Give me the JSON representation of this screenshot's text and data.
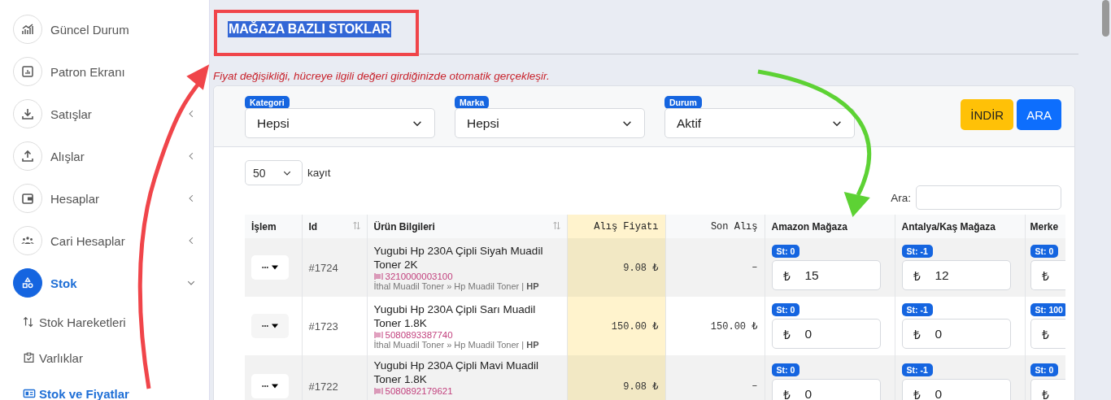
{
  "sidebar": {
    "items": [
      {
        "label": "Güncel Durum",
        "selected": false
      },
      {
        "label": "Patron Ekranı",
        "selected": false
      },
      {
        "label": "Satışlar",
        "selected": false,
        "expanded": false
      },
      {
        "label": "Alışlar",
        "selected": false,
        "expanded": false
      },
      {
        "label": "Hesaplar",
        "selected": false,
        "expanded": false
      },
      {
        "label": "Cari Hesaplar",
        "selected": false,
        "expanded": false
      },
      {
        "label": "Stok",
        "selected": true,
        "expanded": true,
        "children": [
          {
            "label": "Stok Hareketleri",
            "selected": false
          },
          {
            "label": "Varlıklar",
            "selected": false
          },
          {
            "label": "Stok ve Fiyatlar",
            "selected": true
          }
        ]
      }
    ]
  },
  "page": {
    "title": "MAĞAZA BAZLI STOKLAR",
    "note": "Fiyat değişikliği, hücreye ilgili değeri girdiğinizde otomatik gerçekleşir."
  },
  "filters": [
    {
      "label": "Kategori",
      "value": "Hepsi"
    },
    {
      "label": "Marka",
      "value": "Hepsi"
    },
    {
      "label": "Durum",
      "value": "Aktif"
    }
  ],
  "buttons": [
    {
      "label": "İNDİR",
      "kind": "warning"
    },
    {
      "label": "ARA",
      "kind": "primary"
    }
  ],
  "page_length": {
    "value": "50",
    "suffix": "kayıt"
  },
  "search": {
    "label": "Ara:"
  },
  "table": {
    "columns": [
      {
        "label": "İşlem",
        "sortable": false
      },
      {
        "label": "Id",
        "sortable": true
      },
      {
        "label": "Ürün Bilgileri",
        "sortable": true
      },
      {
        "label": "Alış Fiyatı",
        "sortable": false
      },
      {
        "label": "Son Alış",
        "sortable": false
      },
      {
        "label": "Amazon Mağaza",
        "sortable": false
      },
      {
        "label": "Antalya/Kaş Mağaza",
        "sortable": false
      },
      {
        "label": "Merke",
        "sortable": false
      }
    ],
    "rows": [
      {
        "id": "#1724",
        "name": "Yugubi Hp 230A Çipli Siyah Muadil Toner 2K",
        "barcode": "3210000003100",
        "category": "İthal Muadil Toner » Hp Muadil Toner | **HP**",
        "purchase_price": "9.08 ₺",
        "last_purchase": "–",
        "stores": [
          {
            "stock": "St: 0",
            "currency": "₺",
            "price": "15"
          },
          {
            "stock": "St: -1",
            "currency": "₺",
            "price": "12"
          },
          {
            "stock": "St: 0",
            "currency": "₺"
          }
        ]
      },
      {
        "id": "#1723",
        "name": "Yugubi Hp 230A Çipli Sarı Muadil Toner 1.8K",
        "barcode": "5080893387740",
        "category": "İthal Muadil Toner » Hp Muadil Toner | **HP**",
        "purchase_price": "150.00 ₺",
        "last_purchase": "150.00 ₺",
        "stores": [
          {
            "stock": "St: 0",
            "currency": "₺",
            "price": "0"
          },
          {
            "stock": "St: -1",
            "currency": "₺",
            "price": "0"
          },
          {
            "stock": "St: 100",
            "currency": "₺"
          }
        ]
      },
      {
        "id": "#1722",
        "name": "Yugubi Hp 230A Çipli Mavi Muadil Toner 1.8K",
        "barcode": "5080892179621",
        "purchase_price": "9.08 ₺",
        "last_purchase": "–",
        "stores": [
          {
            "stock": "St: 0",
            "currency": "₺",
            "price": "0"
          },
          {
            "stock": "St: -1",
            "currency": "₺",
            "price": "0"
          },
          {
            "stock": "St: 0",
            "currency": "₺"
          }
        ]
      }
    ]
  }
}
